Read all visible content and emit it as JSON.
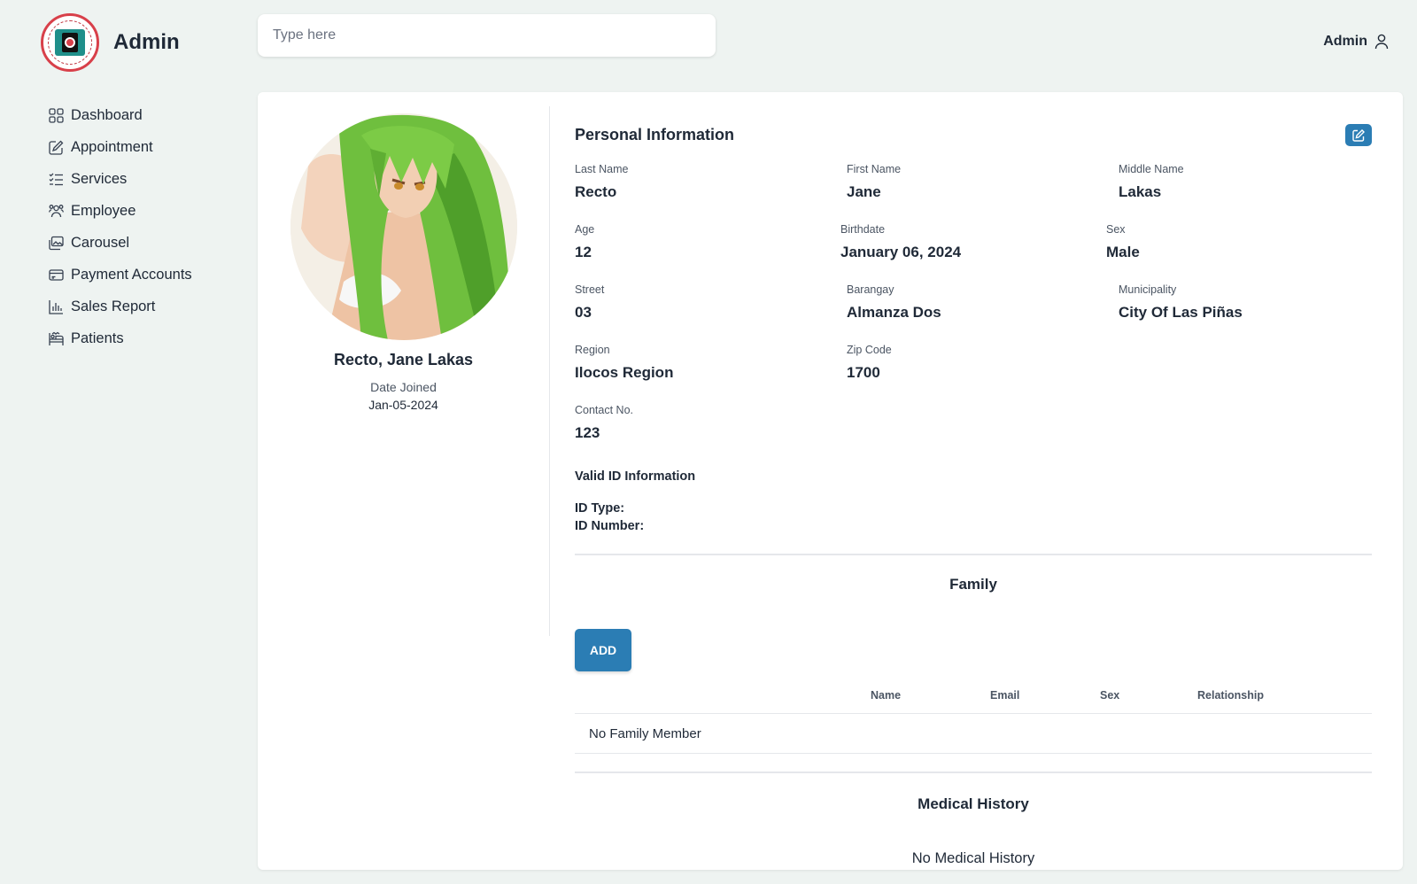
{
  "brand": {
    "title": "Admin"
  },
  "search": {
    "placeholder": "Type here",
    "value": ""
  },
  "user": {
    "name": "Admin"
  },
  "sidebar": {
    "items": [
      {
        "label": "Dashboard",
        "icon": "grid-icon"
      },
      {
        "label": "Appointment",
        "icon": "edit-icon"
      },
      {
        "label": "Services",
        "icon": "checklist-icon"
      },
      {
        "label": "Employee",
        "icon": "users-icon"
      },
      {
        "label": "Carousel",
        "icon": "images-icon"
      },
      {
        "label": "Payment Accounts",
        "icon": "card-icon"
      },
      {
        "label": "Sales Report",
        "icon": "bar-chart-icon"
      },
      {
        "label": "Patients",
        "icon": "bed-icon"
      }
    ]
  },
  "profile": {
    "name": "Recto, Jane Lakas",
    "date_joined_label": "Date Joined",
    "date_joined": "Jan-05-2024"
  },
  "personal": {
    "title": "Personal Information",
    "last_name_label": "Last Name",
    "last_name": "Recto",
    "first_name_label": "First Name",
    "first_name": "Jane",
    "middle_name_label": "Middle Name",
    "middle_name": "Lakas",
    "age_label": "Age",
    "age": "12",
    "birthdate_label": "Birthdate",
    "birthdate": "January 06, 2024",
    "sex_label": "Sex",
    "sex": "Male",
    "street_label": "Street",
    "street": "03",
    "barangay_label": "Barangay",
    "barangay": "Almanza Dos",
    "municipality_label": "Municipality",
    "municipality": "City Of Las Piñas",
    "region_label": "Region",
    "region": "Ilocos Region",
    "zip_label": "Zip Code",
    "zip": "1700",
    "contact_label": "Contact No.",
    "contact": "123"
  },
  "valid_id": {
    "title": "Valid ID Information",
    "type_label": "ID Type:",
    "number_label": "ID Number:"
  },
  "family": {
    "title": "Family",
    "add_label": "ADD",
    "columns": [
      "Name",
      "Email",
      "Sex",
      "Relationship"
    ],
    "empty": "No Family Member"
  },
  "medical": {
    "title": "Medical History",
    "empty": "No Medical History"
  },
  "colors": {
    "accent": "#2b7db4",
    "background": "#eef3f1"
  }
}
